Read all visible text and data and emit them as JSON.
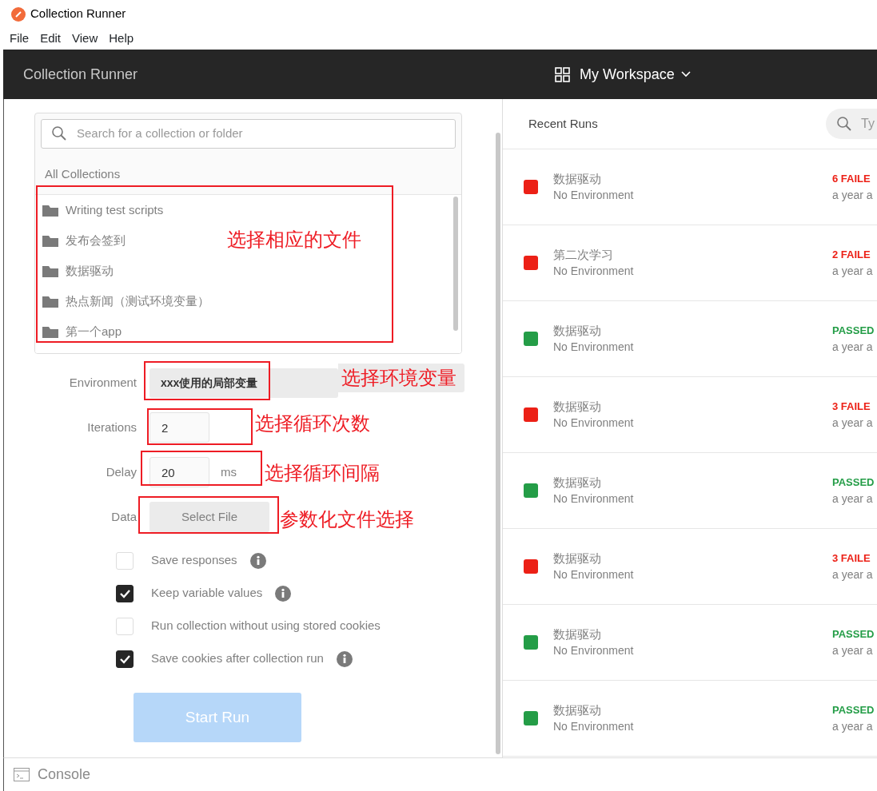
{
  "window": {
    "title": "Collection Runner",
    "menu": [
      "File",
      "Edit",
      "View",
      "Help"
    ]
  },
  "header": {
    "title": "Collection Runner",
    "workspace": "My Workspace"
  },
  "collections": {
    "search_placeholder": "Search for a collection or folder",
    "heading": "All Collections",
    "items": [
      "Writing test scripts",
      "发布会签到",
      "数据驱动",
      "热点新闻（测试环境变量）",
      "第一个app"
    ]
  },
  "form": {
    "environment": {
      "label": "Environment",
      "value": "xxx使用的局部变量"
    },
    "iterations": {
      "label": "Iterations",
      "value": "2"
    },
    "delay": {
      "label": "Delay",
      "value": "20",
      "unit": "ms"
    },
    "data": {
      "label": "Data",
      "button": "Select File"
    }
  },
  "options": [
    {
      "label": "Save responses",
      "checked": false,
      "info": true
    },
    {
      "label": "Keep variable values",
      "checked": true,
      "info": true
    },
    {
      "label": "Run collection without using stored cookies",
      "checked": false,
      "info": false
    },
    {
      "label": "Save cookies after collection run",
      "checked": true,
      "info": true
    }
  ],
  "start_button": {
    "label": "Start Run",
    "disabled": true
  },
  "console": {
    "label": "Console"
  },
  "recent_runs": {
    "title": "Recent Runs",
    "search_placeholder": "Ty",
    "runs": [
      {
        "name": "数据驱动",
        "environment": "No Environment",
        "status": "6 FAILE",
        "passed": false,
        "time": "a year a"
      },
      {
        "name": "第二次学习",
        "environment": "No Environment",
        "status": "2 FAILE",
        "passed": false,
        "time": "a year a"
      },
      {
        "name": "数据驱动",
        "environment": "No Environment",
        "status": "PASSED",
        "passed": true,
        "time": "a year a"
      },
      {
        "name": "数据驱动",
        "environment": "No Environment",
        "status": "3 FAILE",
        "passed": false,
        "time": "a year a"
      },
      {
        "name": "数据驱动",
        "environment": "No Environment",
        "status": "PASSED",
        "passed": true,
        "time": "a year a"
      },
      {
        "name": "数据驱动",
        "environment": "No Environment",
        "status": "3 FAILE",
        "passed": false,
        "time": "a year a"
      },
      {
        "name": "数据驱动",
        "environment": "No Environment",
        "status": "PASSED",
        "passed": true,
        "time": "a year a"
      },
      {
        "name": "数据驱动",
        "environment": "No Environment",
        "status": "PASSED",
        "passed": true,
        "time": "a year a"
      }
    ]
  },
  "annotations": [
    {
      "text": "选择相应的文件"
    },
    {
      "text": "选择环境变量"
    },
    {
      "text": "选择循环次数"
    },
    {
      "text": "选择循环间隔"
    },
    {
      "text": "参数化文件选择"
    }
  ]
}
